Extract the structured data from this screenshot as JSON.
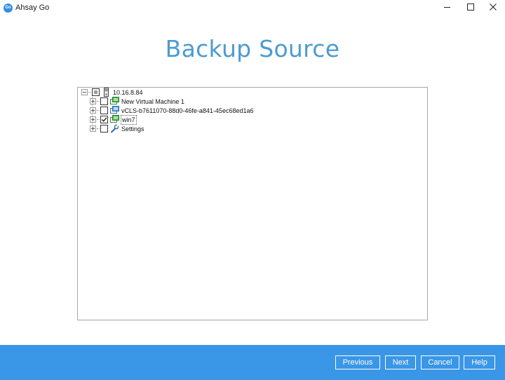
{
  "window": {
    "app_title": "Ahsay Go",
    "logo_text": "Go"
  },
  "page": {
    "title": "Backup Source"
  },
  "tree": {
    "root": {
      "label": "10.16.8.84",
      "icon": "server-icon",
      "check_state": "partial",
      "expanded": true
    },
    "children": [
      {
        "label": "New Virtual Machine 1",
        "icon": "vm-green-icon",
        "checked": false,
        "expanded": false
      },
      {
        "label": "vCLS-b7611070-88d0-46fe-a841-45ec68ed1a6",
        "icon": "vm-blue-icon",
        "checked": false,
        "expanded": false
      },
      {
        "label": "win7",
        "icon": "vm-green-icon",
        "checked": true,
        "expanded": false,
        "focused": true
      },
      {
        "label": "Settings",
        "icon": "wrench-icon",
        "checked": false,
        "expanded": false
      }
    ]
  },
  "footer": {
    "previous_label": "Previous",
    "next_label": "Next",
    "cancel_label": "Cancel",
    "help_label": "Help"
  },
  "colors": {
    "title_blue": "#4c9bd0",
    "footer_blue": "#3a96e6"
  }
}
